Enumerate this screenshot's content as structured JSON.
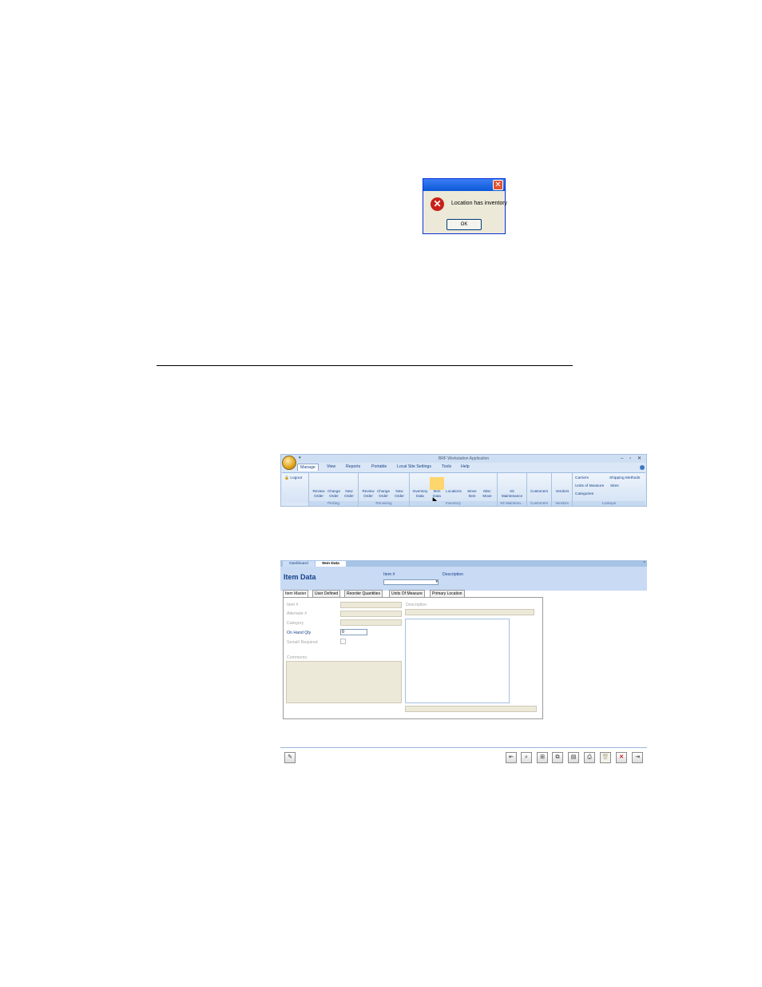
{
  "dialog": {
    "close_glyph": "✕",
    "error_glyph": "✕",
    "message": "Location has inventory",
    "ok_label": "OK"
  },
  "ribbon": {
    "app_title": "BRF Workstation Application",
    "window_controls": "– ▫ ✕",
    "qat": "▾",
    "tabs": [
      "Manage",
      "View",
      "Reports",
      "Portable",
      "Local Site Settings",
      "Tools",
      "Help"
    ],
    "logout": "Logout",
    "buttons": [
      [
        "Review",
        "Order"
      ],
      [
        "Change",
        "Order"
      ],
      [
        "New",
        "Order"
      ],
      [
        "Review",
        "Order"
      ],
      [
        "Change",
        "Order"
      ],
      [
        "New",
        "Order"
      ],
      [
        "Inventory",
        "Data"
      ],
      [
        "Item",
        "Data"
      ],
      [
        "Locations",
        ""
      ],
      [
        "Move",
        "Item"
      ],
      [
        "Misc",
        "Move"
      ],
      [
        "Kit",
        "Maintenance"
      ],
      [
        "Customers",
        ""
      ],
      [
        "Vendors",
        ""
      ]
    ],
    "groups": [
      "Picking",
      "Receiving",
      "Inventory",
      "Kit Maintena...",
      "Customers",
      "Vendors",
      "Lookups"
    ],
    "lookups": {
      "carriers": "Carriers",
      "shipping_methods": "Shipping Methods",
      "units_of_measure": "Units of Measure",
      "sites": "Sites",
      "categories": "Categories"
    }
  },
  "form": {
    "doc_tabs": [
      "Dashboard",
      "Item Data"
    ],
    "close_glyph": "×",
    "title": "Item Data",
    "header_item_label": "Item #",
    "header_desc_label": "Description",
    "dropdown_arrow": "▾",
    "subtabs": [
      "Item Master",
      "User Defined",
      "Reorder Quantities",
      "Units Of Measure",
      "Primary Location"
    ],
    "fields": {
      "item_no": "Item #",
      "alternate_no": "Alternate #",
      "category": "Category",
      "on_hand_qty": "On Hand Qty",
      "on_hand_value": "0",
      "serial_required": "Serial# Required",
      "comments": "Comments",
      "description": "Description"
    },
    "toolbar_icons": [
      "edit-icon",
      "first-record-icon",
      "find-icon",
      "new-record-icon",
      "copy-icon",
      "preview-icon",
      "print-icon",
      "delete-icon",
      "cancel-icon",
      "exit-icon"
    ],
    "toolbar_glyphs": [
      "✎",
      "⇤",
      "⌕",
      "⊞",
      "⧉",
      "▤",
      "⎙",
      "🗑",
      "✕",
      "⇥"
    ]
  }
}
